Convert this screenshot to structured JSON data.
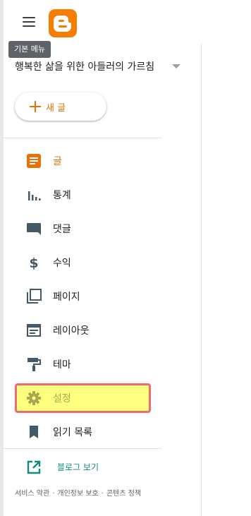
{
  "header": {
    "menu_tooltip": "기본 메뉴",
    "logo_icon": "blogger-logo-icon",
    "brand_color": "#f57d00"
  },
  "blog_selector": {
    "title": "행복한 삶을 위한 아들러의 가르침"
  },
  "new_post": {
    "label": "새 글",
    "icon": "plus-icon"
  },
  "nav": {
    "items": [
      {
        "label": "글",
        "icon": "posts-icon",
        "active": true
      },
      {
        "label": "통계",
        "icon": "stats-icon"
      },
      {
        "label": "댓글",
        "icon": "comment-icon"
      },
      {
        "label": "수익",
        "icon": "dollar-icon"
      },
      {
        "label": "페이지",
        "icon": "pages-icon"
      },
      {
        "label": "레이아웃",
        "icon": "layout-icon"
      },
      {
        "label": "테마",
        "icon": "paint-roller-icon"
      },
      {
        "label": "설정",
        "icon": "gear-icon",
        "highlighted": true
      },
      {
        "label": "읽기 목록",
        "icon": "bookmark-icon"
      }
    ]
  },
  "view_blog": {
    "label": "블로그 보기",
    "icon": "open-in-new-icon"
  },
  "footer": {
    "links": [
      "서비스 약관",
      "개인정보 보호",
      "콘텐츠 정책"
    ],
    "separator": "·"
  },
  "colors": {
    "accent": "#e8710a",
    "icon_gray": "#455a64",
    "highlight_fill": "#ffff80",
    "highlight_border": "#ef6b74",
    "link_teal": "#0f8a7e"
  }
}
